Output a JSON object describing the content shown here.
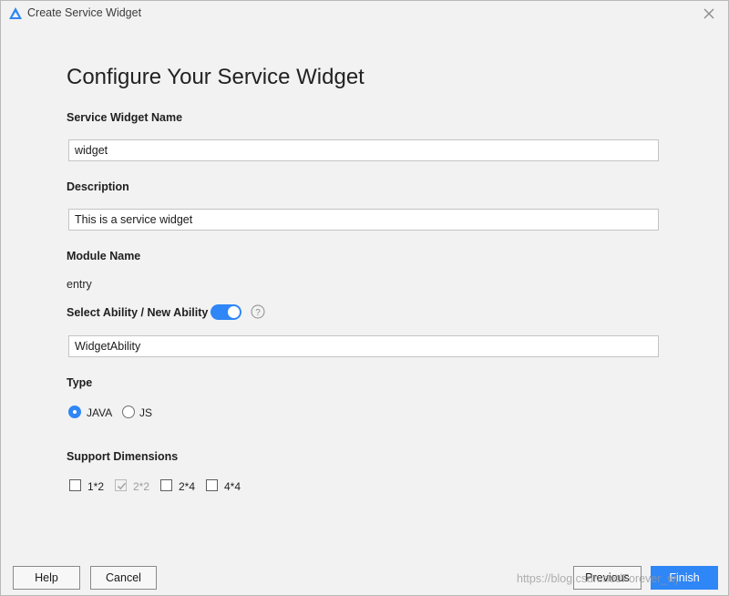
{
  "window": {
    "title": "Create Service Widget"
  },
  "heading": "Configure Your Service Widget",
  "fields": {
    "service_widget_name": {
      "label": "Service Widget Name",
      "value": "widget"
    },
    "description": {
      "label": "Description",
      "value": "This is a service widget"
    },
    "module_name": {
      "label": "Module Name",
      "value": "entry"
    },
    "ability": {
      "label": "Select Ability / New Ability",
      "toggle_on": true,
      "value": "WidgetAbility"
    }
  },
  "type": {
    "label": "Type",
    "options": [
      {
        "label": "JAVA",
        "selected": true
      },
      {
        "label": "JS",
        "selected": false
      }
    ]
  },
  "support_dimensions": {
    "label": "Support Dimensions",
    "options": [
      {
        "label": "1*2",
        "checked": false,
        "disabled": false
      },
      {
        "label": "2*2",
        "checked": true,
        "disabled": true
      },
      {
        "label": "2*4",
        "checked": false,
        "disabled": false
      },
      {
        "label": "4*4",
        "checked": false,
        "disabled": false
      }
    ]
  },
  "buttons": {
    "help": "Help",
    "cancel": "Cancel",
    "previous": "Previous",
    "finish": "Finish"
  },
  "watermark": "https://blog.csdn.net/Forever_wj",
  "colors": {
    "accent": "#2f86f6",
    "background": "#f2f2f2"
  }
}
